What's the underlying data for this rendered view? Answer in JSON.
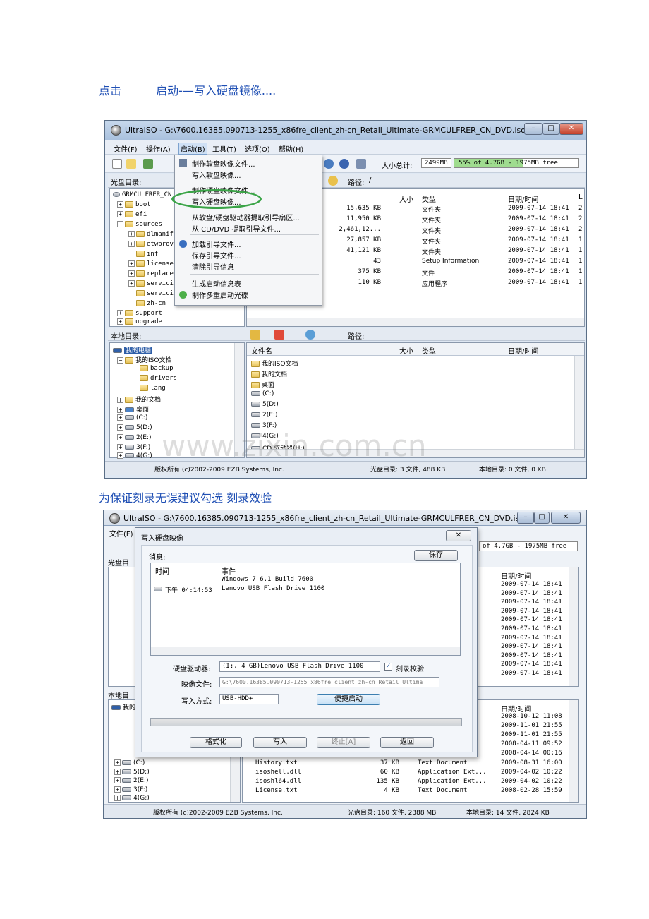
{
  "caption1": {
    "a": "点击",
    "b": "启动-—写入硬盘镜像...."
  },
  "caption2": "为保证刻录无误建议勾选  刻录效验",
  "watermark": "www.zixin.com.cn",
  "shot1": {
    "title": "UltraISO - G:\\7600.16385.090713-1255_x86fre_client_zh-cn_Retail_Ultimate-GRMCULFRER_CN_DVD.iso",
    "menus": [
      "文件(F)",
      "操作(A)",
      "启动(B)",
      "工具(T)",
      "选项(O)",
      "帮助(H)"
    ],
    "size_total_label": "大小总计:",
    "size_total_value": "2499MB",
    "size_bar_text": "55% of 4.7GB - 1975MB free",
    "iso_dir_label": "光盘目录:",
    "path_label": "路径:",
    "path_value": "/",
    "tree_root": "GRMCULFRER_CN",
    "tree": [
      "boot",
      "efi",
      "sources",
      "dlmanif",
      "etwprov",
      "inf",
      "license",
      "replace",
      "servici",
      "servici",
      "zh-cn",
      "support",
      "upgrade"
    ],
    "columns": {
      "size": "大小",
      "type": "类型",
      "datetime": "日期/时间",
      "extra": "L"
    },
    "files": [
      {
        "size": "15,635 KB",
        "type": "文件夹",
        "date": "2009-07-14 18:41",
        "x": "2"
      },
      {
        "size": "11,950 KB",
        "type": "文件夹",
        "date": "2009-07-14 18:41",
        "x": "2"
      },
      {
        "size": "2,461,12...",
        "type": "文件夹",
        "date": "2009-07-14 18:41",
        "x": "2"
      },
      {
        "size": "27,857 KB",
        "type": "文件夹",
        "date": "2009-07-14 18:41",
        "x": "1"
      },
      {
        "size": "41,121 KB",
        "type": "文件夹",
        "date": "2009-07-14 18:41",
        "x": "1"
      },
      {
        "size": "43",
        "type": "Setup Information",
        "date": "2009-07-14 18:41",
        "x": "1"
      },
      {
        "size": "375 KB",
        "type": "文件",
        "date": "2009-07-14 18:41",
        "x": "1"
      },
      {
        "size": "110 KB",
        "type": "应用程序",
        "date": "2009-07-14 18:41",
        "x": "1"
      }
    ],
    "boot_menu": {
      "items": [
        "制作软盘映像文件...",
        "写入软盘映像...",
        "制作硬盘映像文件...",
        "写入硬盘映像...",
        "从软盘/硬盘驱动器提取引导扇区...",
        "从 CD/DVD 提取引导文件...",
        "加载引导文件...",
        "保存引导文件...",
        "清除引导信息",
        "生成启动信息表",
        "制作多重启动光碟"
      ]
    },
    "local_dir_label": "本地目录:",
    "local_tree": [
      "我的电脑",
      "我的ISO文档",
      "backup",
      "drivers",
      "lang",
      "我的文档",
      "桌面",
      "(C:)",
      "5(D:)",
      "2(E:)",
      "3(F:)",
      "4(G:)"
    ],
    "local_cols": {
      "name": "文件名",
      "size": "大小",
      "type": "类型",
      "datetime": "日期/时间"
    },
    "local_files": [
      "我的ISO文档",
      "我的文档",
      "桌面",
      "(C:)",
      "5(D:)",
      "2(E:)",
      "3(F:)",
      "4(G:)",
      "CD 驱动器(H:)"
    ],
    "status": {
      "copyright": "版权所有 (c)2002-2009 EZB Systems, Inc.",
      "iso": "光盘目录: 3 文件, 488 KB",
      "local": "本地目录: 0 文件, 0 KB"
    }
  },
  "shot2": {
    "title": "UltraISO - G:\\7600.16385.090713-1255_x86fre_client_zh-cn_Retail_Ultimate-GRMCULFRER_CN_DVD.iso",
    "menu_file": "文件(F)",
    "iso_dir_label": "光盘目",
    "local_dir_label": "本地目",
    "local_root": "我的",
    "size_bar_text": "of 4.7GB - 1975MB free",
    "dates_top": [
      "2009-07-14 18:41",
      "2009-07-14 18:41",
      "2009-07-14 18:41",
      "2009-07-14 18:41",
      "2009-07-14 18:41",
      "2009-07-14 18:41",
      "2009-07-14 18:41",
      "2009-07-14 18:41",
      "2009-07-14 18:41",
      "2009-07-14 18:41",
      "2009-07-14 18:41"
    ],
    "datetime_label": "日期/时间",
    "dates_bottom": [
      "2008-10-12 11:08",
      "2009-11-01 21:55",
      "2009-11-01 21:55",
      "2008-04-11 09:52",
      "2008-04-14 00:16"
    ],
    "bottom_files": [
      {
        "name": "History.txt",
        "size": "37 KB",
        "type": "Text Document",
        "date": "2009-08-31 16:00"
      },
      {
        "name": "isoshell.dll",
        "size": "60 KB",
        "type": "Application Ext...",
        "date": "2009-04-02 10:22"
      },
      {
        "name": "isoshl64.dll",
        "size": "135 KB",
        "type": "Application Ext...",
        "date": "2009-04-02 10:22"
      },
      {
        "name": "License.txt",
        "size": "4 KB",
        "type": "Text Document",
        "date": "2008-02-28 15:59"
      }
    ],
    "bottom_drives": [
      "(C:)",
      "5(D:)",
      "2(E:)",
      "3(F:)",
      "4(G:)"
    ],
    "status": {
      "copyright": "版权所有 (c)2002-2009 EZB Systems, Inc.",
      "iso": "光盘目录: 160 文件, 2388 MB",
      "local": "本地目录: 14 文件, 2824 KB"
    },
    "dialog": {
      "title": "写入硬盘映像",
      "msg_label": "消息:",
      "save": "保存",
      "col_time": "时间",
      "col_event": "事件",
      "log": [
        {
          "time": "",
          "event": "Windows 7 6.1 Build 7600"
        },
        {
          "time": "下午 04:14:53",
          "event": "Lenovo  USB Flash Drive 1100"
        }
      ],
      "disk_label": "硬盘驱动器:",
      "disk_value": "(I:, 4 GB)Lenovo  USB Flash Drive 1100",
      "verify_label": "刻录校验",
      "image_label": "映像文件:",
      "image_value": "G:\\7600.16385.090713-1255_x86fre_client_zh-cn_Retail_Ultima",
      "method_label": "写入方式:",
      "method_value": "USB-HDD+",
      "quick_boot": "便捷启动",
      "format": "格式化",
      "write": "写入",
      "stop": "终止[A]",
      "back": "返回"
    }
  }
}
